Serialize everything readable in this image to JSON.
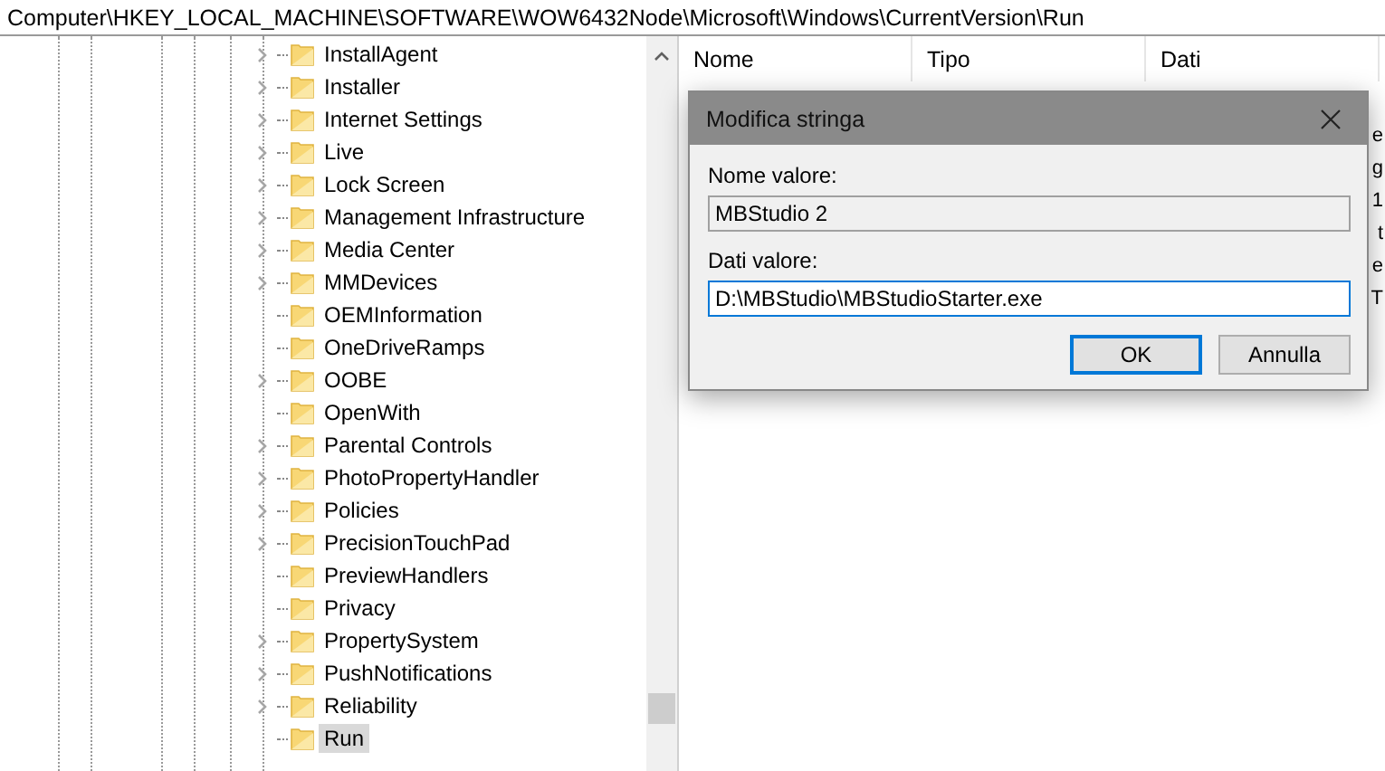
{
  "address_bar": {
    "path": "Computer\\HKEY_LOCAL_MACHINE\\SOFTWARE\\WOW6432Node\\Microsoft\\Windows\\CurrentVersion\\Run"
  },
  "tree": {
    "items": [
      {
        "label": "InstallAgent",
        "has_children": true,
        "selected": false
      },
      {
        "label": "Installer",
        "has_children": true,
        "selected": false
      },
      {
        "label": "Internet Settings",
        "has_children": true,
        "selected": false
      },
      {
        "label": "Live",
        "has_children": true,
        "selected": false
      },
      {
        "label": "Lock Screen",
        "has_children": true,
        "selected": false
      },
      {
        "label": "Management Infrastructure",
        "has_children": true,
        "selected": false
      },
      {
        "label": "Media Center",
        "has_children": true,
        "selected": false
      },
      {
        "label": "MMDevices",
        "has_children": true,
        "selected": false
      },
      {
        "label": "OEMInformation",
        "has_children": false,
        "selected": false
      },
      {
        "label": "OneDriveRamps",
        "has_children": false,
        "selected": false
      },
      {
        "label": "OOBE",
        "has_children": true,
        "selected": false
      },
      {
        "label": "OpenWith",
        "has_children": false,
        "selected": false
      },
      {
        "label": "Parental Controls",
        "has_children": true,
        "selected": false
      },
      {
        "label": "PhotoPropertyHandler",
        "has_children": true,
        "selected": false
      },
      {
        "label": "Policies",
        "has_children": true,
        "selected": false
      },
      {
        "label": "PrecisionTouchPad",
        "has_children": true,
        "selected": false
      },
      {
        "label": "PreviewHandlers",
        "has_children": false,
        "selected": false
      },
      {
        "label": "Privacy",
        "has_children": false,
        "selected": false
      },
      {
        "label": "PropertySystem",
        "has_children": true,
        "selected": false
      },
      {
        "label": "PushNotifications",
        "has_children": true,
        "selected": false
      },
      {
        "label": "Reliability",
        "has_children": true,
        "selected": false
      },
      {
        "label": "Run",
        "has_children": false,
        "selected": true
      }
    ]
  },
  "values_list": {
    "columns": [
      "Nome",
      "Tipo",
      "Dati"
    ],
    "fragments": [
      "e",
      "g",
      "1",
      "t",
      "e",
      "T"
    ]
  },
  "dialog": {
    "title": "Modifica stringa",
    "name_label": "Nome valore:",
    "name_value": "MBStudio 2",
    "data_label": "Dati valore:",
    "data_value": "D:\\MBStudio\\MBStudioStarter.exe",
    "buttons": [
      {
        "label": "OK",
        "default": true
      },
      {
        "label": "Annulla",
        "default": false
      }
    ]
  }
}
